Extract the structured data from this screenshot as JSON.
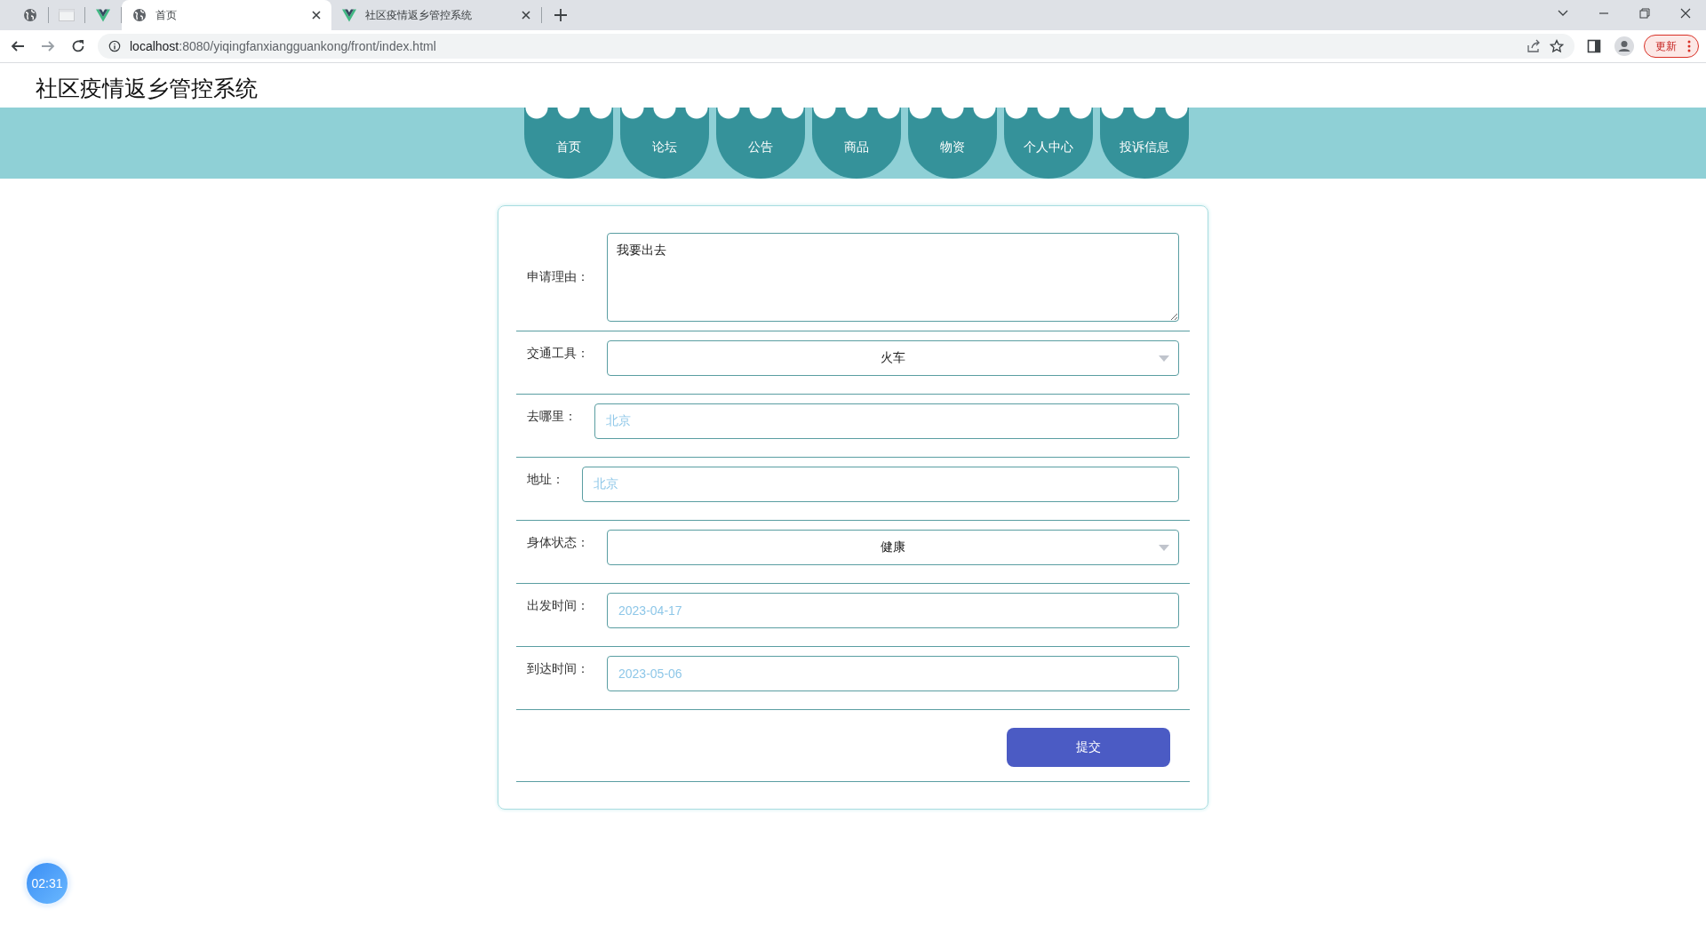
{
  "browser": {
    "tabs": [
      {
        "title": "首页",
        "selected": true
      },
      {
        "title": "社区疫情返乡管控系统",
        "selected": false
      }
    ],
    "address": {
      "host": "localhost",
      "path": ":8080/yiqingfanxiangguankong/front/index.html"
    },
    "update_button": "更新"
  },
  "site_title": "社区疫情返乡管控系统",
  "nav": [
    {
      "label": "首页"
    },
    {
      "label": "论坛"
    },
    {
      "label": "公告"
    },
    {
      "label": "商品"
    },
    {
      "label": "物资"
    },
    {
      "label": "个人中心"
    },
    {
      "label": "投诉信息"
    }
  ],
  "form": {
    "fields": [
      {
        "kind": "textarea",
        "label": "申请理由：",
        "value": "我要出去"
      },
      {
        "kind": "select",
        "label": "交通工具：",
        "value": "火车"
      },
      {
        "kind": "input",
        "label": "去哪里：",
        "value": "北京"
      },
      {
        "kind": "input",
        "label": "地址：",
        "value": "北京"
      },
      {
        "kind": "select",
        "label": "身体状态：",
        "value": "健康"
      },
      {
        "kind": "input",
        "label": "出发时间：",
        "value": "2023-04-17"
      },
      {
        "kind": "input",
        "label": "到达时间：",
        "value": "2023-05-06"
      }
    ],
    "submit_button": "提交"
  },
  "timer": "02:31"
}
